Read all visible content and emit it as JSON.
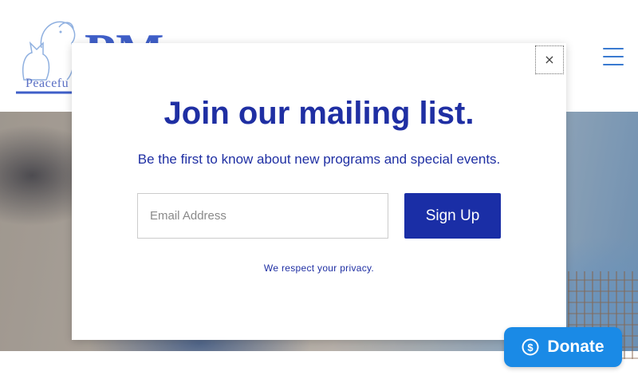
{
  "header": {
    "logo_text": "Peacefu",
    "menu_icon": "hamburger-menu-icon"
  },
  "modal": {
    "close_label": "×",
    "title": "Join our mailing list.",
    "subtitle": "Be the first to know about new programs and special events.",
    "email_placeholder": "Email Address",
    "email_value": "",
    "signup_label": "Sign Up",
    "privacy_text": "We respect your privacy."
  },
  "donate": {
    "icon": "dollar-circle-icon",
    "label": "Donate"
  },
  "colors": {
    "brand_blue": "#1f2fa3",
    "button_blue": "#1a2ea6",
    "donate_blue": "#1a8ae6"
  }
}
